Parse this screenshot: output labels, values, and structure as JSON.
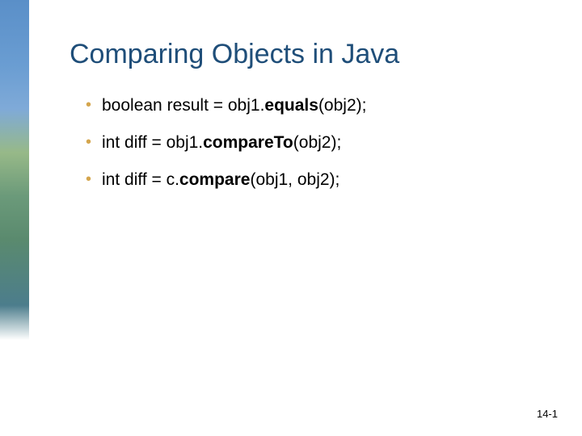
{
  "title": "Comparing Objects in Java",
  "bullets": [
    {
      "pre": "boolean result = obj1.",
      "method": "equals",
      "post": "(obj2);"
    },
    {
      "pre": "int diff = obj1.",
      "method": "compareTo",
      "post": "(obj2);"
    },
    {
      "pre": "int diff = c.",
      "method": "compare",
      "post": "(obj1, obj2);"
    }
  ],
  "pageNumber": "14-1"
}
